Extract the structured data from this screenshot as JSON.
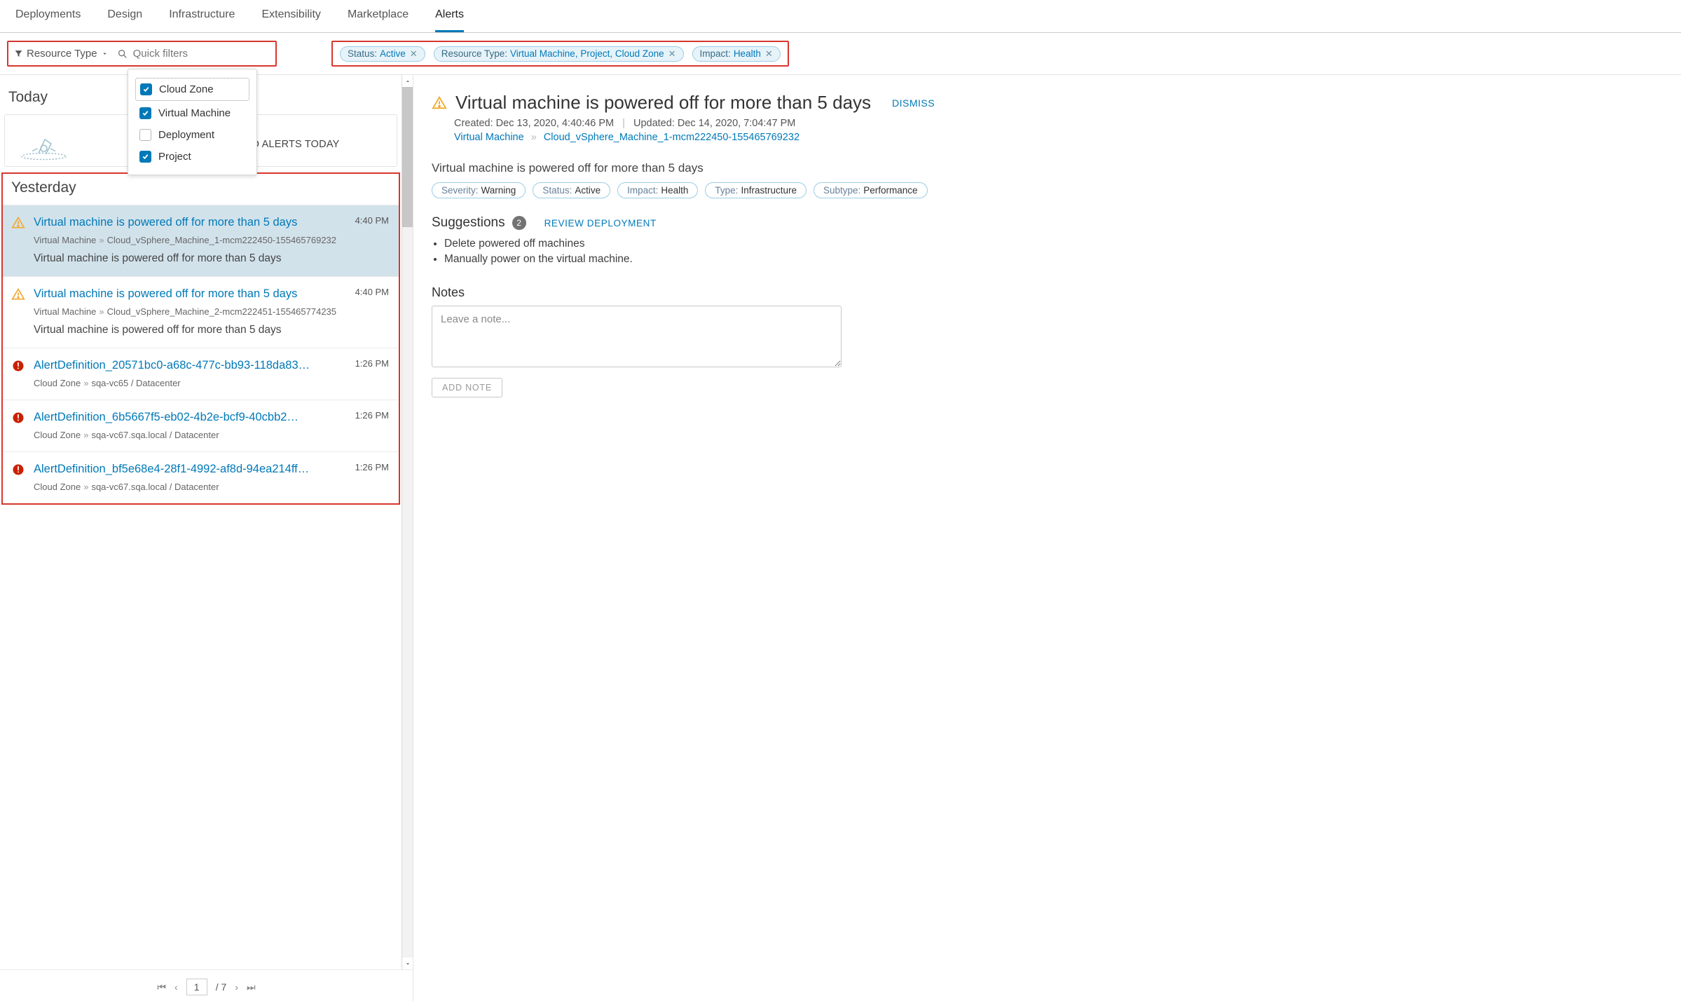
{
  "tabs": {
    "deployments": "Deployments",
    "design": "Design",
    "infrastructure": "Infrastructure",
    "extensibility": "Extensibility",
    "marketplace": "Marketplace",
    "alerts": "Alerts",
    "active": "alerts"
  },
  "filter": {
    "resource_type_label": "Resource Type",
    "quick_filters_placeholder": "Quick filters",
    "options": {
      "cloud_zone": {
        "label": "Cloud Zone",
        "checked": true
      },
      "virtual_machine": {
        "label": "Virtual Machine",
        "checked": true
      },
      "deployment": {
        "label": "Deployment",
        "checked": false
      },
      "project": {
        "label": "Project",
        "checked": true
      }
    }
  },
  "chips": {
    "status": {
      "key": "Status:",
      "value": "Active"
    },
    "restype": {
      "key": "Resource Type:",
      "value": "Virtual Machine, Project, Cloud Zone"
    },
    "impact": {
      "key": "Impact:",
      "value": "Health"
    }
  },
  "sections": {
    "today": "Today",
    "today_empty": "NO ALERTS TODAY",
    "yesterday": "Yesterday"
  },
  "alerts": [
    {
      "severity": "warning",
      "title": "Virtual machine is powered off for more than 5 days",
      "time": "4:40 PM",
      "crumb_type": "Virtual Machine",
      "crumb_name": "Cloud_vSphere_Machine_1-mcm222450-155465769232",
      "desc": "Virtual machine is powered off for more than 5 days",
      "selected": true
    },
    {
      "severity": "warning",
      "title": "Virtual machine is powered off for more than 5 days",
      "time": "4:40 PM",
      "crumb_type": "Virtual Machine",
      "crumb_name": "Cloud_vSphere_Machine_2-mcm222451-155465774235",
      "desc": "Virtual machine is powered off for more than 5 days",
      "selected": false
    },
    {
      "severity": "critical",
      "title": "AlertDefinition_20571bc0-a68c-477c-bb93-118da83…",
      "time": "1:26 PM",
      "crumb_type": "Cloud Zone",
      "crumb_name": "sqa-vc65 / Datacenter",
      "selected": false
    },
    {
      "severity": "critical",
      "title": "AlertDefinition_6b5667f5-eb02-4b2e-bcf9-40cbb2…",
      "time": "1:26 PM",
      "crumb_type": "Cloud Zone",
      "crumb_name": "sqa-vc67.sqa.local / Datacenter",
      "selected": false
    },
    {
      "severity": "critical",
      "title": "AlertDefinition_bf5e68e4-28f1-4992-af8d-94ea214ff…",
      "time": "1:26 PM",
      "crumb_type": "Cloud Zone",
      "crumb_name": "sqa-vc67.sqa.local / Datacenter",
      "selected": false
    }
  ],
  "pager": {
    "page": "1",
    "total": "/ 7"
  },
  "detail": {
    "title": "Virtual machine is powered off for more than 5 days",
    "dismiss": "DISMISS",
    "created_label": "Created:",
    "created_value": "Dec 13, 2020, 4:40:46 PM",
    "updated_label": "Updated:",
    "updated_value": "Dec 14, 2020, 7:04:47 PM",
    "crumb_type": "Virtual Machine",
    "crumb_name": "Cloud_vSphere_Machine_1-mcm222450-155465769232",
    "message": "Virtual machine is powered off for more than 5 days",
    "pills": {
      "severity": {
        "k": "Severity:",
        "v": "Warning"
      },
      "status": {
        "k": "Status:",
        "v": "Active"
      },
      "impact": {
        "k": "Impact:",
        "v": "Health"
      },
      "type": {
        "k": "Type:",
        "v": "Infrastructure"
      },
      "subtype": {
        "k": "Subtype:",
        "v": "Performance"
      }
    },
    "suggestions_label": "Suggestions",
    "suggestions_count": "2",
    "review_label": "REVIEW DEPLOYMENT",
    "suggestions": [
      "Delete powered off machines",
      "Manually power on the virtual machine."
    ],
    "notes_label": "Notes",
    "notes_placeholder": "Leave a note...",
    "add_note_label": "ADD NOTE"
  }
}
